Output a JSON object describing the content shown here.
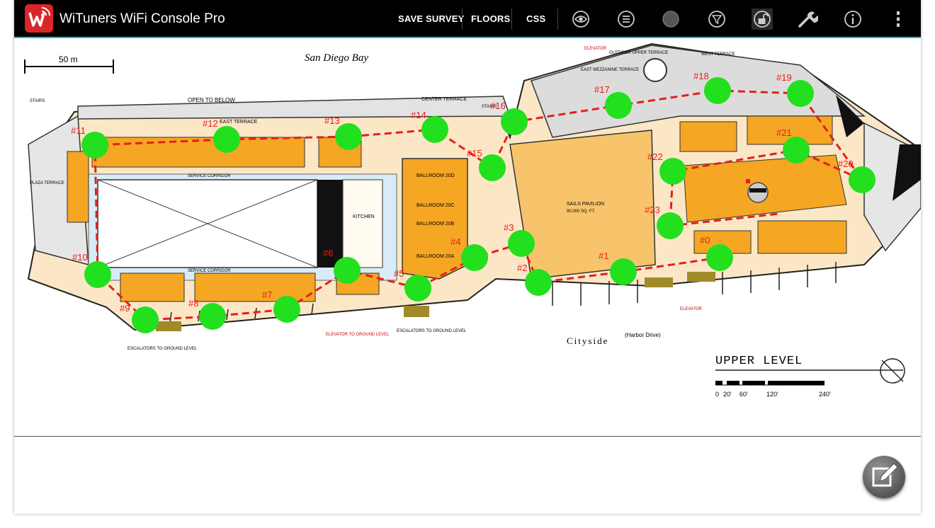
{
  "app": {
    "title": "WiTuners WiFi Console Pro",
    "accent_color": "#33b5e5",
    "actions": [
      {
        "label": "SAVE SURVEY"
      },
      {
        "label": "FLOORS"
      },
      {
        "label": "CSS"
      }
    ],
    "icons": [
      "eye-icon",
      "list-icon",
      "record-icon",
      "filter-icon",
      "unlock-icon",
      "wrench-icon",
      "info-icon",
      "overflow-menu-icon"
    ]
  },
  "map": {
    "scale_label": "50 m",
    "bay_label": "San Diego Bay",
    "cityside_label": "Cityside",
    "harbor_label": "(Harbor Drive)",
    "level_label": "UPPER LEVEL",
    "scale_ticks": [
      "0",
      "20'",
      "60'",
      "120'",
      "240'"
    ],
    "rooms": {
      "open_below": "OPEN TO BELOW",
      "center_terrace": "CENTER TERRACE",
      "east_terrace": "EAST TERRACE",
      "service_corridor": "SERVICE CORRIDOR",
      "kitchen": "KITCHEN",
      "plaza_terrace": "PLAZA TERRACE",
      "ballroom_20d": "BALLROOM 20D",
      "ballroom_20c": "BALLROOM 20C",
      "ballroom_20b": "BALLROOM 20B",
      "ballroom_20a": "BALLROOM 20A",
      "sails_pavilion": "SAILS PAVILION",
      "sails_area": "90,000 SQ. FT.",
      "east_mezzanine": "EAST MEZZANINE TERRACE",
      "outdoor_terrace": "OUTDOOR UPPER TERRACE",
      "west_terrace": "WEST TERRACE",
      "stairs": "STAIRS",
      "elevator": "ELEVATOR",
      "escalators_ground": "ESCALATORS TO GROUND LEVEL",
      "elevator_ground": "ELEVATOR TO GROUND LEVEL"
    },
    "survey_points": [
      {
        "label": "#0"
      },
      {
        "label": "#1"
      },
      {
        "label": "#2"
      },
      {
        "label": "#3"
      },
      {
        "label": "#4"
      },
      {
        "label": "#5"
      },
      {
        "label": "#6"
      },
      {
        "label": "#7"
      },
      {
        "label": "#8"
      },
      {
        "label": "#9"
      },
      {
        "label": "#10"
      },
      {
        "label": "#11"
      },
      {
        "label": "#12"
      },
      {
        "label": "#13"
      },
      {
        "label": "#14"
      },
      {
        "label": "#15"
      },
      {
        "label": "#16"
      },
      {
        "label": "#17"
      },
      {
        "label": "#18"
      },
      {
        "label": "#19"
      },
      {
        "label": "#20"
      },
      {
        "label": "#21"
      },
      {
        "label": "#22"
      },
      {
        "label": "#23"
      }
    ],
    "colors": {
      "room_orange": "#f5a623",
      "floor_cream": "#fbe7c6",
      "corridor_blue": "#d8ecf5",
      "point_green": "#22e01e",
      "path_red": "#e3201b"
    }
  }
}
